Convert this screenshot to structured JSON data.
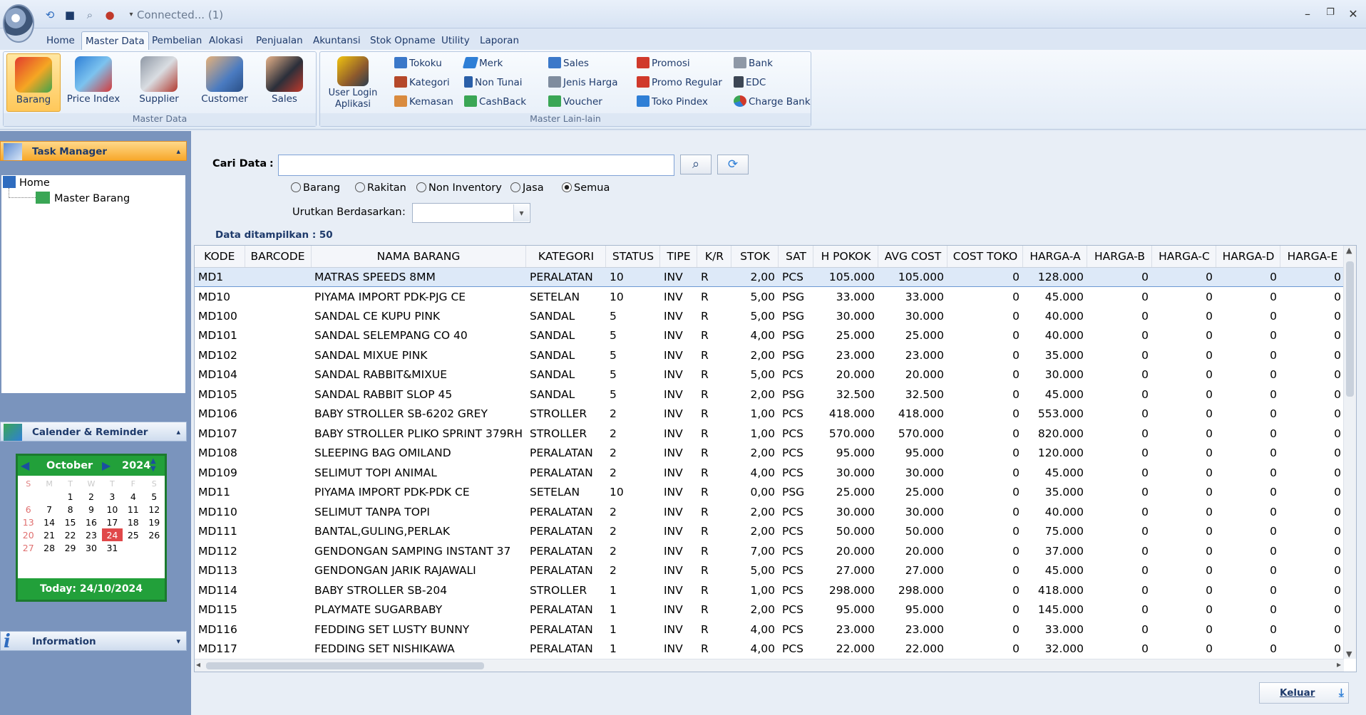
{
  "titlebar": {
    "connection": "Connected... (1)",
    "minimize": "–",
    "restore": "❐",
    "close": "✕"
  },
  "tabs": [
    "Home",
    "Master Data",
    "Pembelian",
    "Alokasi",
    "Penjualan",
    "Akuntansi",
    "Stok Opname",
    "Utility",
    "Laporan"
  ],
  "ribbon": {
    "master_data": {
      "label": "Master Data",
      "buttons": [
        "Barang",
        "Price Index",
        "Supplier",
        "Customer",
        "Sales"
      ]
    },
    "master_lain": {
      "label": "Master Lain-lain",
      "user_login": [
        "User Login",
        "Aplikasi"
      ],
      "col1": [
        "Tokoku",
        "Kategori",
        "Kemasan"
      ],
      "col2": [
        "Merk",
        "Non Tunai",
        "CashBack"
      ],
      "col3": [
        "Sales",
        "Jenis Harga",
        "Voucher"
      ],
      "col4": [
        "Promosi",
        "Promo Regular",
        "Toko Pindex"
      ],
      "col5": [
        "Bank",
        "EDC",
        "Charge Bank"
      ]
    }
  },
  "task_manager": {
    "title": "Task Manager",
    "tree_root": "Home",
    "tree_child": "Master Barang"
  },
  "calendar": {
    "title": "Calender & Reminder",
    "month": "October",
    "year": "2024",
    "weekdays": [
      "S",
      "M",
      "T",
      "W",
      "T",
      "F",
      "S"
    ],
    "weeks": [
      [
        "",
        "",
        "1",
        "2",
        "3",
        "4",
        "5"
      ],
      [
        "6",
        "7",
        "8",
        "9",
        "10",
        "11",
        "12"
      ],
      [
        "13",
        "14",
        "15",
        "16",
        "17",
        "18",
        "19"
      ],
      [
        "20",
        "21",
        "22",
        "23",
        "24",
        "25",
        "26"
      ],
      [
        "27",
        "28",
        "29",
        "30",
        "31",
        "",
        ""
      ]
    ],
    "today_day": "24",
    "today": "Today: 24/10/2024"
  },
  "information": {
    "title": "Information"
  },
  "search": {
    "label": "Cari Data",
    "colon": ":",
    "value": "",
    "filters": [
      "Barang",
      "Rakitan",
      "Non Inventory",
      "Jasa",
      "Semua"
    ],
    "selected_filter": "Semua",
    "sort_label": "Urutkan Berdasarkan",
    "sort_colon": ":",
    "sort_value": "",
    "count_text": "Data ditampilkan : 50"
  },
  "table": {
    "columns": [
      "KODE",
      "BARCODE",
      "NAMA BARANG",
      "KATEGORI",
      "STATUS",
      "TIPE",
      "K/R",
      "STOK",
      "SAT",
      "H POKOK",
      "AVG COST",
      "COST TOKO",
      "HARGA-A",
      "HARGA-B",
      "HARGA-C",
      "HARGA-D",
      "HARGA-E"
    ],
    "rows": [
      [
        "MD1",
        "",
        "MATRAS SPEEDS 8MM",
        "PERALATAN",
        "10",
        "INV",
        "R",
        "2,00",
        "PCS",
        "105.000",
        "105.000",
        "0",
        "128.000",
        "0",
        "0",
        "0",
        "0"
      ],
      [
        "MD10",
        "",
        "PIYAMA IMPORT PDK-PJG CE",
        "SETELAN",
        "10",
        "INV",
        "R",
        "5,00",
        "PSG",
        "33.000",
        "33.000",
        "0",
        "45.000",
        "0",
        "0",
        "0",
        "0"
      ],
      [
        "MD100",
        "",
        "SANDAL CE KUPU PINK",
        "SANDAL",
        "5",
        "INV",
        "R",
        "5,00",
        "PSG",
        "30.000",
        "30.000",
        "0",
        "40.000",
        "0",
        "0",
        "0",
        "0"
      ],
      [
        "MD101",
        "",
        "SANDAL SELEMPANG CO 40",
        "SANDAL",
        "5",
        "INV",
        "R",
        "4,00",
        "PSG",
        "25.000",
        "25.000",
        "0",
        "40.000",
        "0",
        "0",
        "0",
        "0"
      ],
      [
        "MD102",
        "",
        "SANDAL MIXUE PINK",
        "SANDAL",
        "5",
        "INV",
        "R",
        "2,00",
        "PSG",
        "23.000",
        "23.000",
        "0",
        "35.000",
        "0",
        "0",
        "0",
        "0"
      ],
      [
        "MD104",
        "",
        "SANDAL RABBIT&MIXUE",
        "SANDAL",
        "5",
        "INV",
        "R",
        "5,00",
        "PCS",
        "20.000",
        "20.000",
        "0",
        "30.000",
        "0",
        "0",
        "0",
        "0"
      ],
      [
        "MD105",
        "",
        "SANDAL RABBIT SLOP 45",
        "SANDAL",
        "5",
        "INV",
        "R",
        "2,00",
        "PSG",
        "32.500",
        "32.500",
        "0",
        "45.000",
        "0",
        "0",
        "0",
        "0"
      ],
      [
        "MD106",
        "",
        "BABY STROLLER SB-6202 GREY",
        "STROLLER",
        "2",
        "INV",
        "R",
        "1,00",
        "PCS",
        "418.000",
        "418.000",
        "0",
        "553.000",
        "0",
        "0",
        "0",
        "0"
      ],
      [
        "MD107",
        "",
        "BABY STROLLER PLIKO SPRINT 379RH",
        "STROLLER",
        "2",
        "INV",
        "R",
        "1,00",
        "PCS",
        "570.000",
        "570.000",
        "0",
        "820.000",
        "0",
        "0",
        "0",
        "0"
      ],
      [
        "MD108",
        "",
        "SLEEPING BAG OMILAND",
        "PERALATAN",
        "2",
        "INV",
        "R",
        "2,00",
        "PCS",
        "95.000",
        "95.000",
        "0",
        "120.000",
        "0",
        "0",
        "0",
        "0"
      ],
      [
        "MD109",
        "",
        "SELIMUT TOPI ANIMAL",
        "PERALATAN",
        "2",
        "INV",
        "R",
        "4,00",
        "PCS",
        "30.000",
        "30.000",
        "0",
        "45.000",
        "0",
        "0",
        "0",
        "0"
      ],
      [
        "MD11",
        "",
        "PIYAMA IMPORT PDK-PDK CE",
        "SETELAN",
        "10",
        "INV",
        "R",
        "0,00",
        "PSG",
        "25.000",
        "25.000",
        "0",
        "35.000",
        "0",
        "0",
        "0",
        "0"
      ],
      [
        "MD110",
        "",
        "SELIMUT TANPA TOPI",
        "PERALATAN",
        "2",
        "INV",
        "R",
        "2,00",
        "PCS",
        "30.000",
        "30.000",
        "0",
        "40.000",
        "0",
        "0",
        "0",
        "0"
      ],
      [
        "MD111",
        "",
        "BANTAL,GULING,PERLAK",
        "PERALATAN",
        "2",
        "INV",
        "R",
        "2,00",
        "PCS",
        "50.000",
        "50.000",
        "0",
        "75.000",
        "0",
        "0",
        "0",
        "0"
      ],
      [
        "MD112",
        "",
        "GENDONGAN SAMPING INSTANT 37",
        "PERALATAN",
        "2",
        "INV",
        "R",
        "7,00",
        "PCS",
        "20.000",
        "20.000",
        "0",
        "37.000",
        "0",
        "0",
        "0",
        "0"
      ],
      [
        "MD113",
        "",
        "GENDONGAN JARIK RAJAWALI",
        "PERALATAN",
        "2",
        "INV",
        "R",
        "5,00",
        "PCS",
        "27.000",
        "27.000",
        "0",
        "45.000",
        "0",
        "0",
        "0",
        "0"
      ],
      [
        "MD114",
        "",
        "BABY STROLLER SB-204",
        "STROLLER",
        "1",
        "INV",
        "R",
        "1,00",
        "PCS",
        "298.000",
        "298.000",
        "0",
        "418.000",
        "0",
        "0",
        "0",
        "0"
      ],
      [
        "MD115",
        "",
        "PLAYMATE SUGARBABY",
        "PERALATAN",
        "1",
        "INV",
        "R",
        "2,00",
        "PCS",
        "95.000",
        "95.000",
        "0",
        "145.000",
        "0",
        "0",
        "0",
        "0"
      ],
      [
        "MD116",
        "",
        "FEDDING SET LUSTY BUNNY",
        "PERALATAN",
        "1",
        "INV",
        "R",
        "4,00",
        "PCS",
        "23.000",
        "23.000",
        "0",
        "33.000",
        "0",
        "0",
        "0",
        "0"
      ],
      [
        "MD117",
        "",
        "FEDDING SET NISHIKAWA",
        "PERALATAN",
        "1",
        "INV",
        "R",
        "4,00",
        "PCS",
        "22.000",
        "22.000",
        "0",
        "32.000",
        "0",
        "0",
        "0",
        "0"
      ]
    ]
  },
  "footer": {
    "exit_label": "Keluar"
  }
}
